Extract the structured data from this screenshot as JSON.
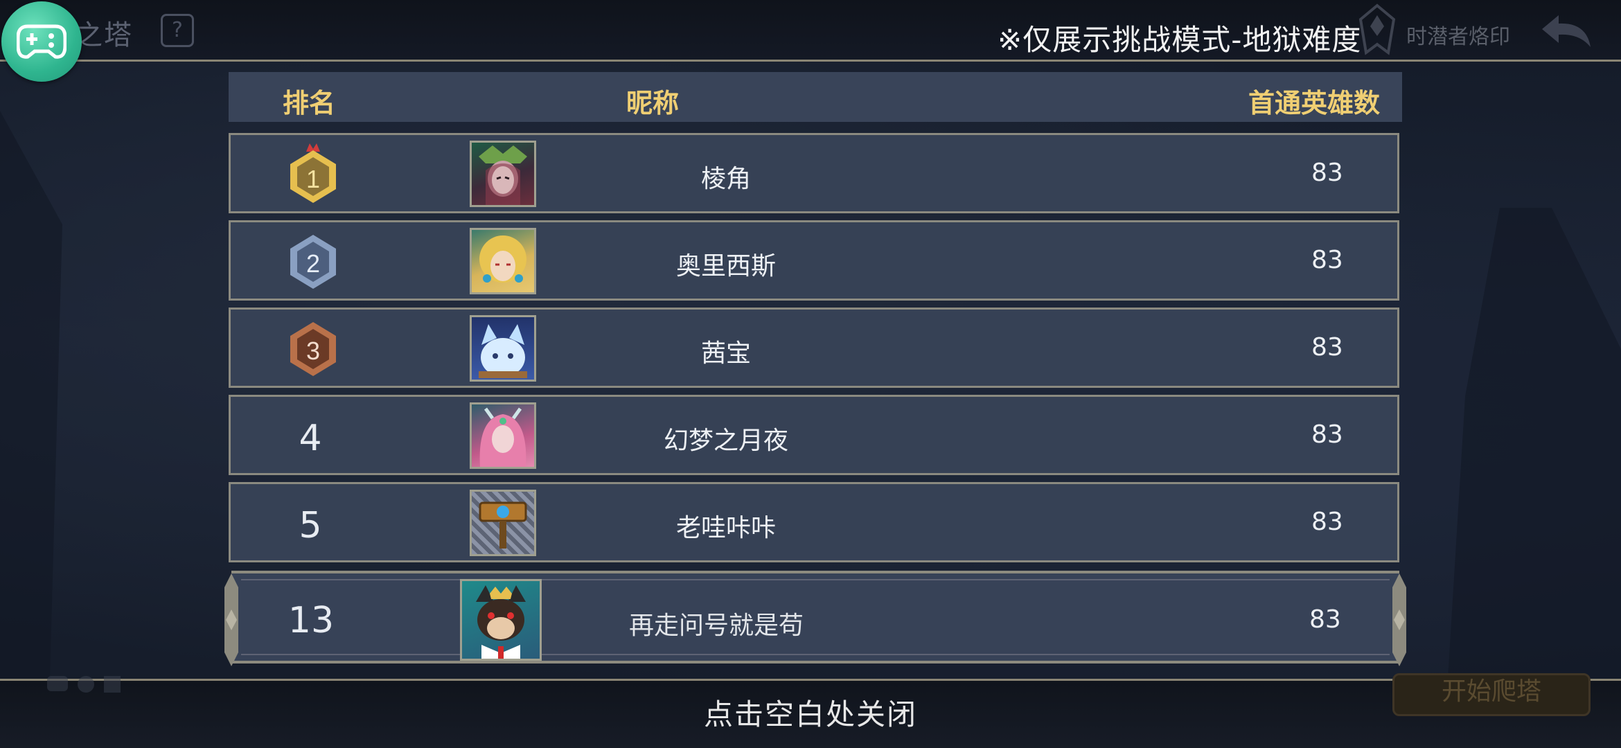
{
  "background": {
    "title": "之塔",
    "help_icon": "question-icon",
    "mark_label": "时潜者烙印",
    "start_button": "开始爬塔",
    "back_icon": "back-arrow-icon"
  },
  "notice": "※仅展示挑战模式-地狱难度",
  "table": {
    "headers": {
      "rank": "排名",
      "nickname": "昵称",
      "count": "首通英雄数"
    },
    "rows": [
      {
        "rank": "1",
        "nickname": "棱角",
        "count": "83",
        "badge": "gold"
      },
      {
        "rank": "2",
        "nickname": "奥里西斯",
        "count": "83",
        "badge": "silver"
      },
      {
        "rank": "3",
        "nickname": "茜宝",
        "count": "83",
        "badge": "bronze"
      },
      {
        "rank": "4",
        "nickname": "幻梦之月夜",
        "count": "83"
      },
      {
        "rank": "5",
        "nickname": "老哇咔咔",
        "count": "83"
      }
    ],
    "self": {
      "rank": "13",
      "nickname": "再走问号就是苟",
      "count": "83"
    }
  },
  "close_hint": "点击空白处关闭",
  "colors": {
    "header_text": "#f0cf73",
    "gold": "#e6bf4f",
    "silver": "#8aa0c2",
    "bronze": "#b9714a",
    "accent_green": "#2fb58f"
  }
}
